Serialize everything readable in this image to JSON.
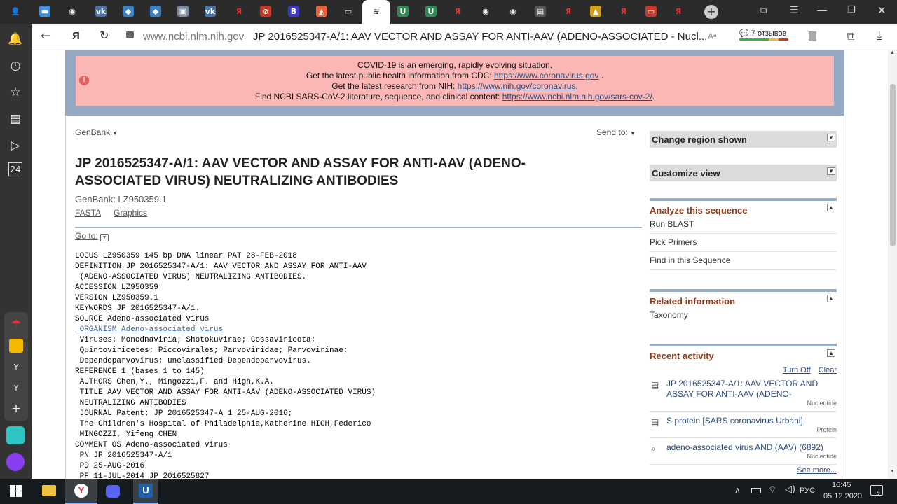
{
  "tabs": [
    {
      "icon": "user-icon",
      "color": "#2b2b2b",
      "glyph": "👤"
    },
    {
      "icon": "chat-icon",
      "color": "#4a90d9",
      "glyph": "▬"
    },
    {
      "icon": "github-icon",
      "color": "#2b2b2b",
      "glyph": "◉"
    },
    {
      "icon": "vk-icon",
      "color": "#4a76a8",
      "glyph": "vk"
    },
    {
      "icon": "app-icon",
      "color": "#3b82c4",
      "glyph": "◆"
    },
    {
      "icon": "app-icon",
      "color": "#3b82c4",
      "glyph": "◆"
    },
    {
      "icon": "image-icon",
      "color": "#7a8aa5",
      "glyph": "▣"
    },
    {
      "icon": "vk-icon",
      "color": "#4a76a8",
      "glyph": "vk"
    },
    {
      "icon": "yandex-icon",
      "color": "#2b2b2b",
      "glyph": "Я"
    },
    {
      "icon": "blocked-icon",
      "color": "#c0392b",
      "glyph": "⊘"
    },
    {
      "icon": "b-icon",
      "color": "#3b3bbf",
      "glyph": "B"
    },
    {
      "icon": "orange-app-icon",
      "color": "#e8643a",
      "glyph": "◭"
    },
    {
      "icon": "document-icon",
      "color": "#2b2b2b",
      "glyph": "▭"
    },
    {
      "icon": "ncbi-icon",
      "color": "#fff",
      "glyph": "≋"
    },
    {
      "icon": "u-icon",
      "color": "#2e8b57",
      "glyph": "U"
    },
    {
      "icon": "u-icon",
      "color": "#2e8b57",
      "glyph": "U"
    },
    {
      "icon": "yandex-icon",
      "color": "#2b2b2b",
      "glyph": "Я"
    },
    {
      "icon": "github-icon",
      "color": "#2b2b2b",
      "glyph": "◉"
    },
    {
      "icon": "github-icon",
      "color": "#2b2b2b",
      "glyph": "◉"
    },
    {
      "icon": "image-icon",
      "color": "#555",
      "glyph": "▤"
    },
    {
      "icon": "yandex-icon",
      "color": "#2b2b2b",
      "glyph": "Я"
    },
    {
      "icon": "image-icon",
      "color": "#d4a017",
      "glyph": "▲"
    },
    {
      "icon": "yandex-icon",
      "color": "#2b2b2b",
      "glyph": "Я"
    },
    {
      "icon": "pdf-icon",
      "color": "#c0392b",
      "glyph": "▭"
    },
    {
      "icon": "yandex-icon",
      "color": "#2b2b2b",
      "glyph": "Я"
    }
  ],
  "address": {
    "host": "www.ncbi.nlm.nih.gov",
    "title": "JP 2016525347-A/1: AAV VECTOR AND ASSAY FOR ANTI-AAV (ADENO-ASSOCIATED - Nucl...",
    "reviews": "7 отзывов"
  },
  "banner": {
    "line1": "COVID-19 is an emerging, rapidly evolving situation.",
    "line2_pre": "Get the latest public health information from CDC: ",
    "line2_link": "https://www.coronavirus.gov",
    "line2_post": " .",
    "line3_pre": "Get the latest research from NIH: ",
    "line3_link": "https://www.nih.gov/coronavirus",
    "line3_post": ".",
    "line4_pre": "Find NCBI SARS-CoV-2 literature, sequence, and clinical content: ",
    "line4_link": "https://www.ncbi.nlm.nih.gov/sars-cov-2/",
    "line4_post": "."
  },
  "main": {
    "format": "GenBank",
    "sendto": "Send to:",
    "title": "JP 2016525347-A/1: AAV VECTOR AND ASSAY FOR ANTI-AAV (ADENO-ASSOCIATED VIRUS) NEUTRALIZING ANTIBODIES",
    "accession": "GenBank: LZ950359.1",
    "link_fasta": "FASTA",
    "link_graphics": "Graphics",
    "goto": "Go to:",
    "record": [
      "LOCUS LZ950359 145 bp DNA linear PAT 28-FEB-2018",
      "DEFINITION JP 2016525347-A/1: AAV VECTOR AND ASSAY FOR ANTI-AAV",
      " (ADENO-ASSOCIATED VIRUS) NEUTRALIZING ANTIBODIES.",
      "ACCESSION LZ950359",
      "VERSION LZ950359.1",
      "KEYWORDS JP 2016525347-A/1.",
      "SOURCE Adeno-associated virus"
    ],
    "organism": " ORGANISM Adeno-associated virus",
    "record2": [
      " Viruses; Monodnaviria; Shotokuvirae; Cossaviricota;",
      " Quintoviricetes; Piccovirales; Parvoviridae; Parvovirinae;",
      " Dependoparvovirus; unclassified Dependoparvovirus.",
      "REFERENCE 1 (bases 1 to 145)",
      " AUTHORS Chen,Y., Mingozzi,F. and High,K.A.",
      " TITLE AAV VECTOR AND ASSAY FOR ANTI-AAV (ADENO-ASSOCIATED VIRUS)",
      " NEUTRALIZING ANTIBODIES",
      " JOURNAL Patent: JP 2016525347-A 1 25-AUG-2016;",
      " The Children's Hospital of Philadelphia,Katherine HIGH,Federico",
      " MINGOZZI, Yifeng CHEN",
      "COMMENT OS Adeno-associated virus",
      " PN JP 2016525347-A/1",
      " PD 25-AUG-2016",
      " PF 11-JUL-2014 JP 2016525827"
    ]
  },
  "side": {
    "change_region": "Change region shown",
    "customize": "Customize view",
    "analyze": {
      "title": "Analyze this sequence",
      "items": [
        "Run BLAST",
        "Pick Primers",
        "Find in this Sequence"
      ]
    },
    "related": {
      "title": "Related information",
      "items": [
        "Taxonomy"
      ]
    },
    "recent": {
      "title": "Recent activity",
      "turnoff": "Turn Off",
      "clear": "Clear",
      "items": [
        {
          "text": "JP 2016525347-A/1: AAV VECTOR AND ASSAY FOR ANTI-AAV (ADENO-",
          "type": "Nucleotide",
          "icon": "document-icon"
        },
        {
          "text": "S protein [SARS coronavirus Urbani]",
          "type": "Protein",
          "icon": "document-icon"
        },
        {
          "text": "adeno-associated virus AND (AAV) (6892)",
          "type": "Nucleotide",
          "icon": "search-icon"
        }
      ],
      "seemore": "See more..."
    }
  },
  "taskbar": {
    "lang": "РУС",
    "time": "16:45",
    "date": "05.12.2020",
    "notif": "2"
  }
}
